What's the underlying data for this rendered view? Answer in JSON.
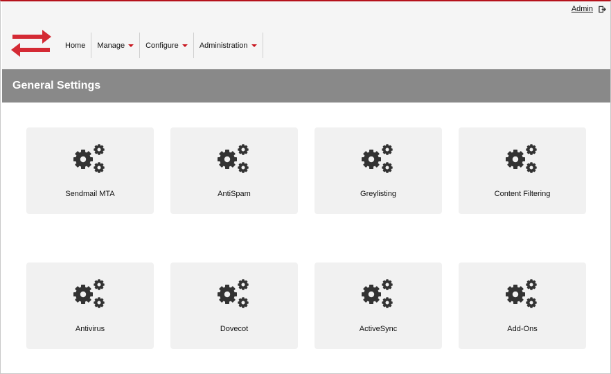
{
  "header": {
    "user_link": "Admin",
    "nav": [
      {
        "label": "Home"
      },
      {
        "label": "Manage"
      },
      {
        "label": "Configure"
      },
      {
        "label": "Administration"
      }
    ]
  },
  "page_title": "General Settings",
  "tiles": [
    {
      "label": "Sendmail MTA",
      "icon": "gears-icon"
    },
    {
      "label": "AntiSpam",
      "icon": "gears-icon"
    },
    {
      "label": "Greylisting",
      "icon": "gears-icon"
    },
    {
      "label": "Content Filtering",
      "icon": "gears-icon"
    },
    {
      "label": "Antivirus",
      "icon": "gears-icon"
    },
    {
      "label": "Dovecot",
      "icon": "gears-icon"
    },
    {
      "label": "ActiveSync",
      "icon": "gears-icon"
    },
    {
      "label": "Add-Ons",
      "icon": "gears-icon"
    }
  ],
  "colors": {
    "accent": "#c8121b",
    "title_bar": "#898989",
    "tile_bg": "#f1f1f1",
    "icon": "#333333"
  }
}
